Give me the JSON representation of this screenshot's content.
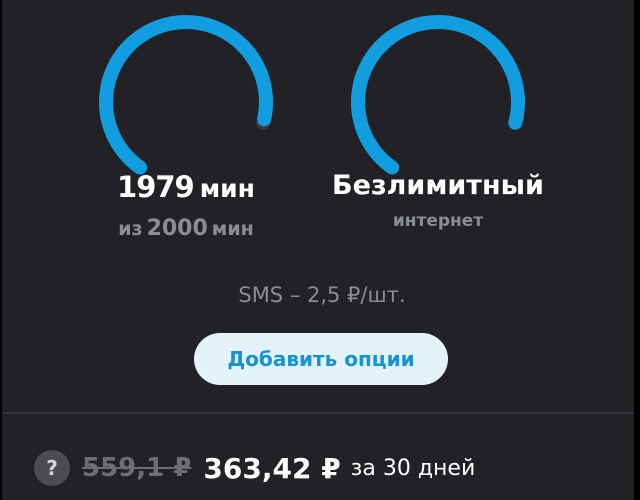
{
  "colors": {
    "accent": "#129de1",
    "background": "#222226",
    "button_bg": "#e4f3fa",
    "button_text": "#1593d2",
    "muted_text": "#8a8d95"
  },
  "minutes": {
    "used": "1979",
    "unit": "мин",
    "prefix": "из",
    "total": "2000",
    "total_unit": "мин",
    "remaining_fraction": 0.9895
  },
  "internet": {
    "value": "Безлимитный",
    "label": "интернет",
    "remaining_fraction": 1
  },
  "sms": {
    "text": "SMS – 2,5 ₽/шт."
  },
  "add_options": {
    "label": "Добавить опции"
  },
  "price": {
    "help_icon": "question-icon",
    "help_glyph": "?",
    "old": "559,1 ₽",
    "new": "363,42 ₽",
    "period": "за 30 дней"
  }
}
